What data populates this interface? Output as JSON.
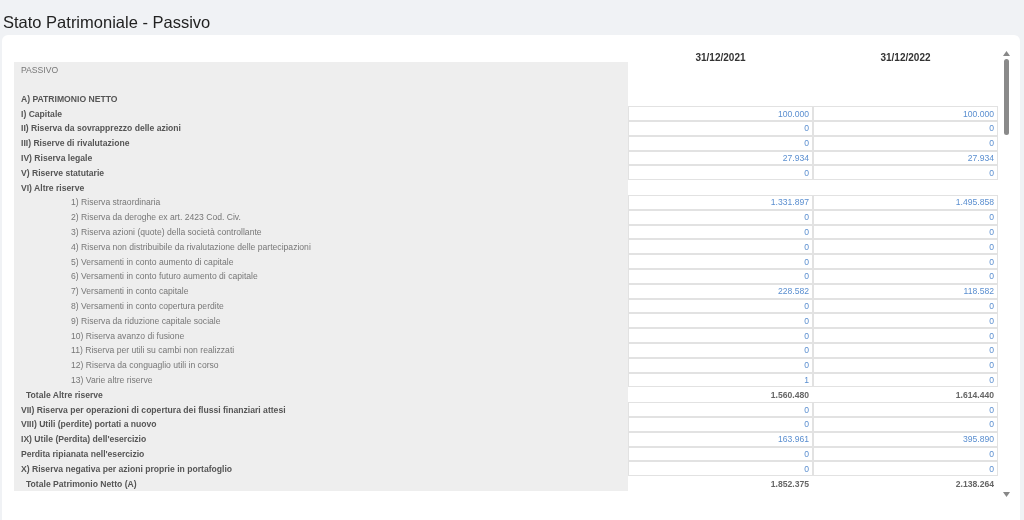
{
  "page_title": "Stato Patrimoniale - Passivo",
  "table": {
    "columns": [
      "31/12/2021",
      "31/12/2022"
    ],
    "section_label": "PASSIVO",
    "rows": [
      {
        "kind": "heading",
        "label": "A) PATRIMONIO NETTO"
      },
      {
        "kind": "item",
        "label": "I) Capitale",
        "values": [
          "100.000",
          "100.000"
        ]
      },
      {
        "kind": "item",
        "label": "II) Riserva da sovrapprezzo delle azioni",
        "values": [
          "0",
          "0"
        ]
      },
      {
        "kind": "item",
        "label": "III) Riserve di rivalutazione",
        "values": [
          "0",
          "0"
        ]
      },
      {
        "kind": "item",
        "label": "IV) Riserva legale",
        "values": [
          "27.934",
          "27.934"
        ]
      },
      {
        "kind": "item",
        "label": "V) Riserve statutarie",
        "values": [
          "0",
          "0"
        ]
      },
      {
        "kind": "heading",
        "label": "VI) Altre riserve"
      },
      {
        "kind": "subitem",
        "label": "1) Riserva straordinaria",
        "values": [
          "1.331.897",
          "1.495.858"
        ]
      },
      {
        "kind": "subitem",
        "label": "2) Riserva da deroghe ex art. 2423 Cod. Civ.",
        "values": [
          "0",
          "0"
        ]
      },
      {
        "kind": "subitem",
        "label": "3) Riserva azioni (quote) della società controllante",
        "values": [
          "0",
          "0"
        ]
      },
      {
        "kind": "subitem",
        "label": "4) Riserva non distribuibile da rivalutazione delle partecipazioni",
        "values": [
          "0",
          "0"
        ]
      },
      {
        "kind": "subitem",
        "label": "5) Versamenti in conto aumento di capitale",
        "values": [
          "0",
          "0"
        ]
      },
      {
        "kind": "subitem",
        "label": "6) Versamenti in conto futuro aumento di capitale",
        "values": [
          "0",
          "0"
        ]
      },
      {
        "kind": "subitem",
        "label": "7) Versamenti in conto capitale",
        "values": [
          "228.582",
          "118.582"
        ]
      },
      {
        "kind": "subitem",
        "label": "8) Versamenti in conto copertura perdite",
        "values": [
          "0",
          "0"
        ]
      },
      {
        "kind": "subitem",
        "label": "9) Riserva da riduzione capitale sociale",
        "values": [
          "0",
          "0"
        ]
      },
      {
        "kind": "subitem",
        "label": "10) Riserva avanzo di fusione",
        "values": [
          "0",
          "0"
        ]
      },
      {
        "kind": "subitem",
        "label": "11) Riserva per utili su cambi non realizzati",
        "values": [
          "0",
          "0"
        ]
      },
      {
        "kind": "subitem",
        "label": "12) Riserva da conguaglio utili in corso",
        "values": [
          "0",
          "0"
        ]
      },
      {
        "kind": "subitem",
        "label": "13) Varie altre riserve",
        "values": [
          "1",
          "0"
        ]
      },
      {
        "kind": "total",
        "label": "Totale Altre riserve",
        "values": [
          "1.560.480",
          "1.614.440"
        ]
      },
      {
        "kind": "item",
        "label": "VII) Riserva per operazioni di copertura dei flussi finanziari attesi",
        "values": [
          "0",
          "0"
        ]
      },
      {
        "kind": "item",
        "label": "VIII) Utili (perdite) portati a nuovo",
        "values": [
          "0",
          "0"
        ]
      },
      {
        "kind": "item",
        "label": "IX) Utile (Perdita) dell'esercizio",
        "values": [
          "163.961",
          "395.890"
        ]
      },
      {
        "kind": "item",
        "label": "Perdita ripianata nell'esercizio",
        "values": [
          "0",
          "0"
        ]
      },
      {
        "kind": "item",
        "label": "X) Riserva negativa per azioni proprie in portafoglio",
        "values": [
          "0",
          "0"
        ]
      },
      {
        "kind": "total",
        "label": "Totale Patrimonio Netto (A)",
        "values": [
          "1.852.375",
          "2.138.264"
        ]
      }
    ]
  }
}
